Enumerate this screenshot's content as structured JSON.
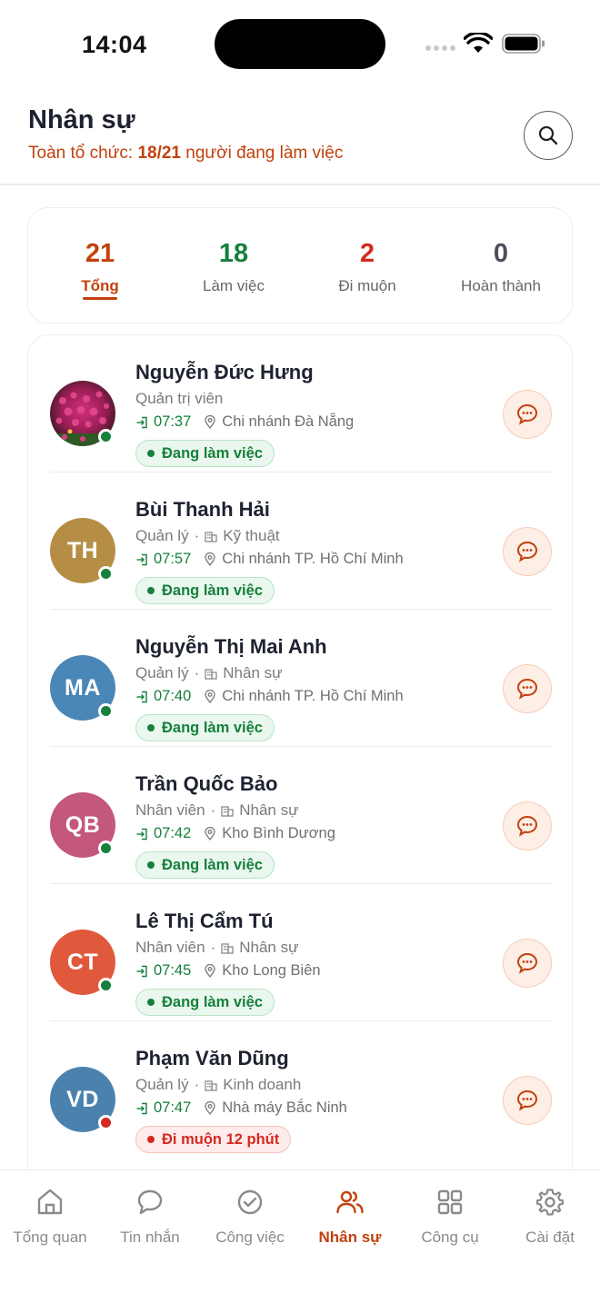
{
  "status_bar": {
    "time": "14:04"
  },
  "header": {
    "title": "Nhân sự",
    "org_prefix": "Toàn tổ chức: ",
    "org_count": "18/21",
    "org_suffix": " người đang làm việc"
  },
  "stats": [
    {
      "value": "21",
      "label": "Tổng",
      "color": "#c2410c"
    },
    {
      "value": "18",
      "label": "Làm việc",
      "color": "#16803c"
    },
    {
      "value": "2",
      "label": "Đi muộn",
      "color": "#d42a1f"
    },
    {
      "value": "0",
      "label": "Hoàn thành",
      "color": "#4b4f5a"
    }
  ],
  "employees": [
    {
      "name": "Nguyễn Đức Hưng",
      "role": "Quản trị viên",
      "dept": "",
      "initials": "",
      "checkin": "07:37",
      "location": "Chi nhánh Đà Nẵng",
      "status": "Đang làm việc",
      "status_type": "working",
      "avatar_color": "photo"
    },
    {
      "name": "Bùi Thanh Hải",
      "role": "Quản lý",
      "dept": "Kỹ thuật",
      "initials": "TH",
      "checkin": "07:57",
      "location": "Chi nhánh TP. Hồ Chí Minh",
      "status": "Đang làm việc",
      "status_type": "working",
      "avatar_color": "#b58d45"
    },
    {
      "name": "Nguyễn Thị Mai Anh",
      "role": "Quản lý",
      "dept": "Nhân sự",
      "initials": "MA",
      "checkin": "07:40",
      "location": "Chi nhánh TP. Hồ Chí Minh",
      "status": "Đang làm việc",
      "status_type": "working",
      "avatar_color": "#4a86b6"
    },
    {
      "name": "Trần Quốc Bảo",
      "role": "Nhân viên",
      "dept": "Nhân sự",
      "initials": "QB",
      "checkin": "07:42",
      "location": "Kho Bình Dương",
      "status": "Đang làm việc",
      "status_type": "working",
      "avatar_color": "#c4587a"
    },
    {
      "name": "Lê Thị Cẩm Tú",
      "role": "Nhân viên",
      "dept": "Nhân sự",
      "initials": "CT",
      "checkin": "07:45",
      "location": "Kho Long Biên",
      "status": "Đang làm việc",
      "status_type": "working",
      "avatar_color": "#e0593d"
    },
    {
      "name": "Phạm Văn Dũng",
      "role": "Quản lý",
      "dept": "Kinh doanh",
      "initials": "VD",
      "checkin": "07:47",
      "location": "Nhà máy Bắc Ninh",
      "status": "Đi muộn 12 phút",
      "status_type": "late",
      "avatar_color": "#4b82ad"
    }
  ],
  "nav": [
    {
      "label": "Tổng quan",
      "icon": "home-icon",
      "active": false
    },
    {
      "label": "Tin nhắn",
      "icon": "chat-icon",
      "active": false
    },
    {
      "label": "Công việc",
      "icon": "task-check-icon",
      "active": false
    },
    {
      "label": "Nhân sự",
      "icon": "people-icon",
      "active": true
    },
    {
      "label": "Công cụ",
      "icon": "grid-icon",
      "active": false
    },
    {
      "label": "Cài đặt",
      "icon": "gear-icon",
      "active": false
    }
  ]
}
